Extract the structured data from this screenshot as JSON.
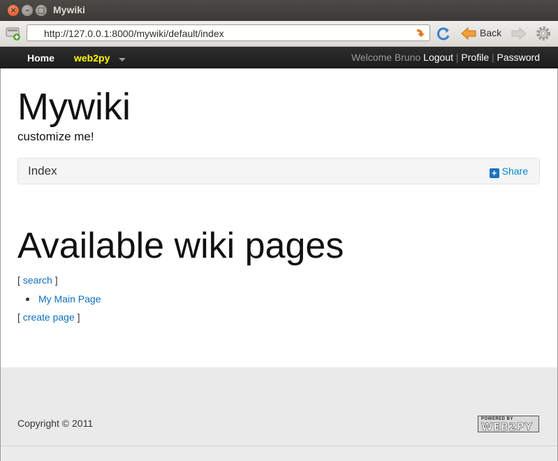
{
  "window": {
    "title": "Mywiki"
  },
  "browser": {
    "url": "http://127.0.0.1:8000/mywiki/default/index",
    "back_label": "Back"
  },
  "navbar": {
    "home": "Home",
    "brand": "web2py",
    "welcome": "Welcome Bruno",
    "logout": "Logout",
    "profile": "Profile",
    "password": "Password",
    "separator": "|"
  },
  "page": {
    "title": "Mywiki",
    "subtitle": "customize me!",
    "breadcrumb": "Index",
    "share": "Share",
    "heading": "Available wiki pages",
    "search_link": "search",
    "pages": [
      "My Main Page"
    ],
    "create_link": "create page",
    "bracket_open": "[",
    "bracket_close": "]"
  },
  "footer": {
    "copyright": "Copyright © 2011",
    "powered_small": "POWERED BY",
    "powered_main": "WEB2PY"
  },
  "colors": {
    "link": "#0d6fbf",
    "brand": "#ffff00",
    "navbar": "#222222"
  }
}
